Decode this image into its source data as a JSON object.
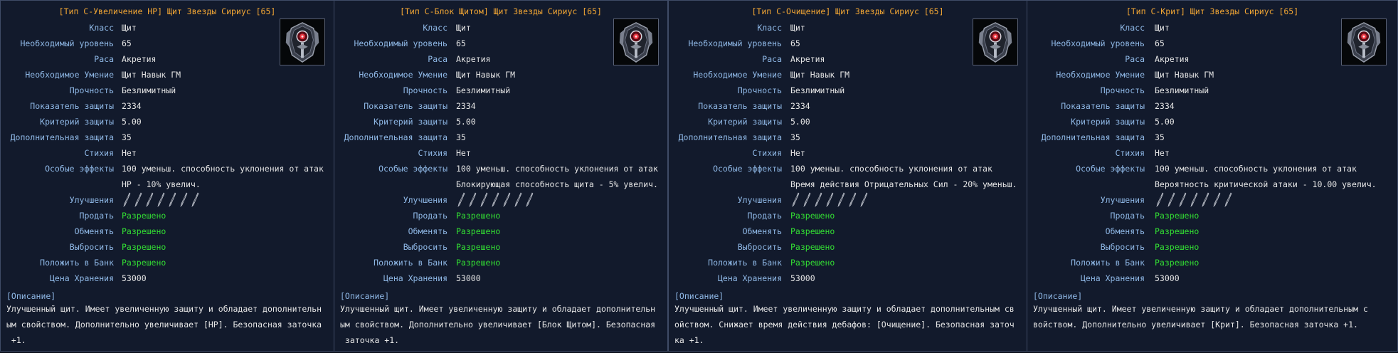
{
  "labels": {
    "class": "Класс",
    "level": "Необходимый уровень",
    "race": "Раса",
    "skill": "Необходимое Умение",
    "durability": "Прочность",
    "defense": "Показатель защиты",
    "crit_def": "Критерий защиты",
    "extra_def": "Дополнительная защита",
    "element": "Стихия",
    "special": "Особые эффекты",
    "upgrades": "Улучшения",
    "sell": "Продать",
    "trade": "Обменять",
    "drop": "Выбросить",
    "bank": "Положить в Банк",
    "storage_price": "Цена Хранения"
  },
  "colors": {
    "title": "#f2a634",
    "label": "#8fb8e6",
    "value": "#e6e6e6",
    "allowed": "#33e033",
    "panel_bg": "#121a2c",
    "border": "#3f4b66"
  },
  "icons": {
    "item": "shield-icon",
    "upgrade_slot": "upgrade-slot-icon"
  },
  "upgrade_slots": 7,
  "cards": [
    {
      "title": "[Тип С-Увеличение HP] Щит Звезды Сириус [65]",
      "class": "Щит",
      "level": "65",
      "race": "Акретия",
      "skill": "Щит Навык ГМ",
      "durability": "Безлимитный",
      "defense": "2334",
      "crit_def": "5.00",
      "extra_def": "35",
      "element": "Нет",
      "special_1": "100 уменьш. способность уклонения от атак",
      "special_2": "HP - 10% увелич.",
      "sell": "Разрешено",
      "trade": "Разрешено",
      "drop": "Разрешено",
      "bank": "Разрешено",
      "storage_price": "53000",
      "desc_heading": "[Описание]",
      "desc_lines": [
        "Улучшенный щит. Имеет увеличенную защиту и обладает дополнительн",
        "ым свойством. Дополнительно увеличивает [HP]. Безопасная заточка",
        " +1."
      ]
    },
    {
      "title": "[Тип С-Блок Щитом] Щит Звезды Сириус [65]",
      "class": "Щит",
      "level": "65",
      "race": "Акретия",
      "skill": "Щит Навык ГМ",
      "durability": "Безлимитный",
      "defense": "2334",
      "crit_def": "5.00",
      "extra_def": "35",
      "element": "Нет",
      "special_1": "100 уменьш. способность уклонения от атак",
      "special_2": "Блокирующая способность щита - 5% увелич.",
      "sell": "Разрешено",
      "trade": "Разрешено",
      "drop": "Разрешено",
      "bank": "Разрешено",
      "storage_price": "53000",
      "desc_heading": "[Описание]",
      "desc_lines": [
        "Улучшенный щит. Имеет увеличенную защиту и обладает дополнительн",
        "ым свойством. Дополнительно увеличивает [Блок Щитом]. Безопасная",
        " заточка +1."
      ]
    },
    {
      "title": "[Тип С-Очищение] Щит Звезды Сириус [65]",
      "class": "Щит",
      "level": "65",
      "race": "Акретия",
      "skill": "Щит Навык ГМ",
      "durability": "Безлимитный",
      "defense": "2334",
      "crit_def": "5.00",
      "extra_def": "35",
      "element": "Нет",
      "special_1": "100 уменьш. способность уклонения от атак",
      "special_2": "Время действия Отрицательных Сил - 20% уменьш.",
      "sell": "Разрешено",
      "trade": "Разрешено",
      "drop": "Разрешено",
      "bank": "Разрешено",
      "storage_price": "53000",
      "desc_heading": "[Описание]",
      "desc_lines": [
        "Улучшенный щит. Имеет увеличенную защиту и обладает дополнительным св",
        "ойством. Снижает время действия дебафов: [Очищение]. Безопасная заточ",
        "ка +1."
      ]
    },
    {
      "title": "[Тип С-Крит] Щит Звезды Сириус [65]",
      "class": "Щит",
      "level": "65",
      "race": "Акретия",
      "skill": "Щит Навык ГМ",
      "durability": "Безлимитный",
      "defense": "2334",
      "crit_def": "5.00",
      "extra_def": "35",
      "element": "Нет",
      "special_1": "100 уменьш. способность уклонения от атак",
      "special_2": "Вероятность критической атаки - 10.00 увелич.",
      "sell": "Разрешено",
      "trade": "Разрешено",
      "drop": "Разрешено",
      "bank": "Разрешено",
      "storage_price": "53000",
      "desc_heading": "[Описание]",
      "desc_lines": [
        "Улучшенный щит. Имеет увеличенную защиту и обладает дополнительным с",
        "войством. Дополнительно увеличивает [Крит]. Безопасная заточка +1."
      ]
    }
  ]
}
